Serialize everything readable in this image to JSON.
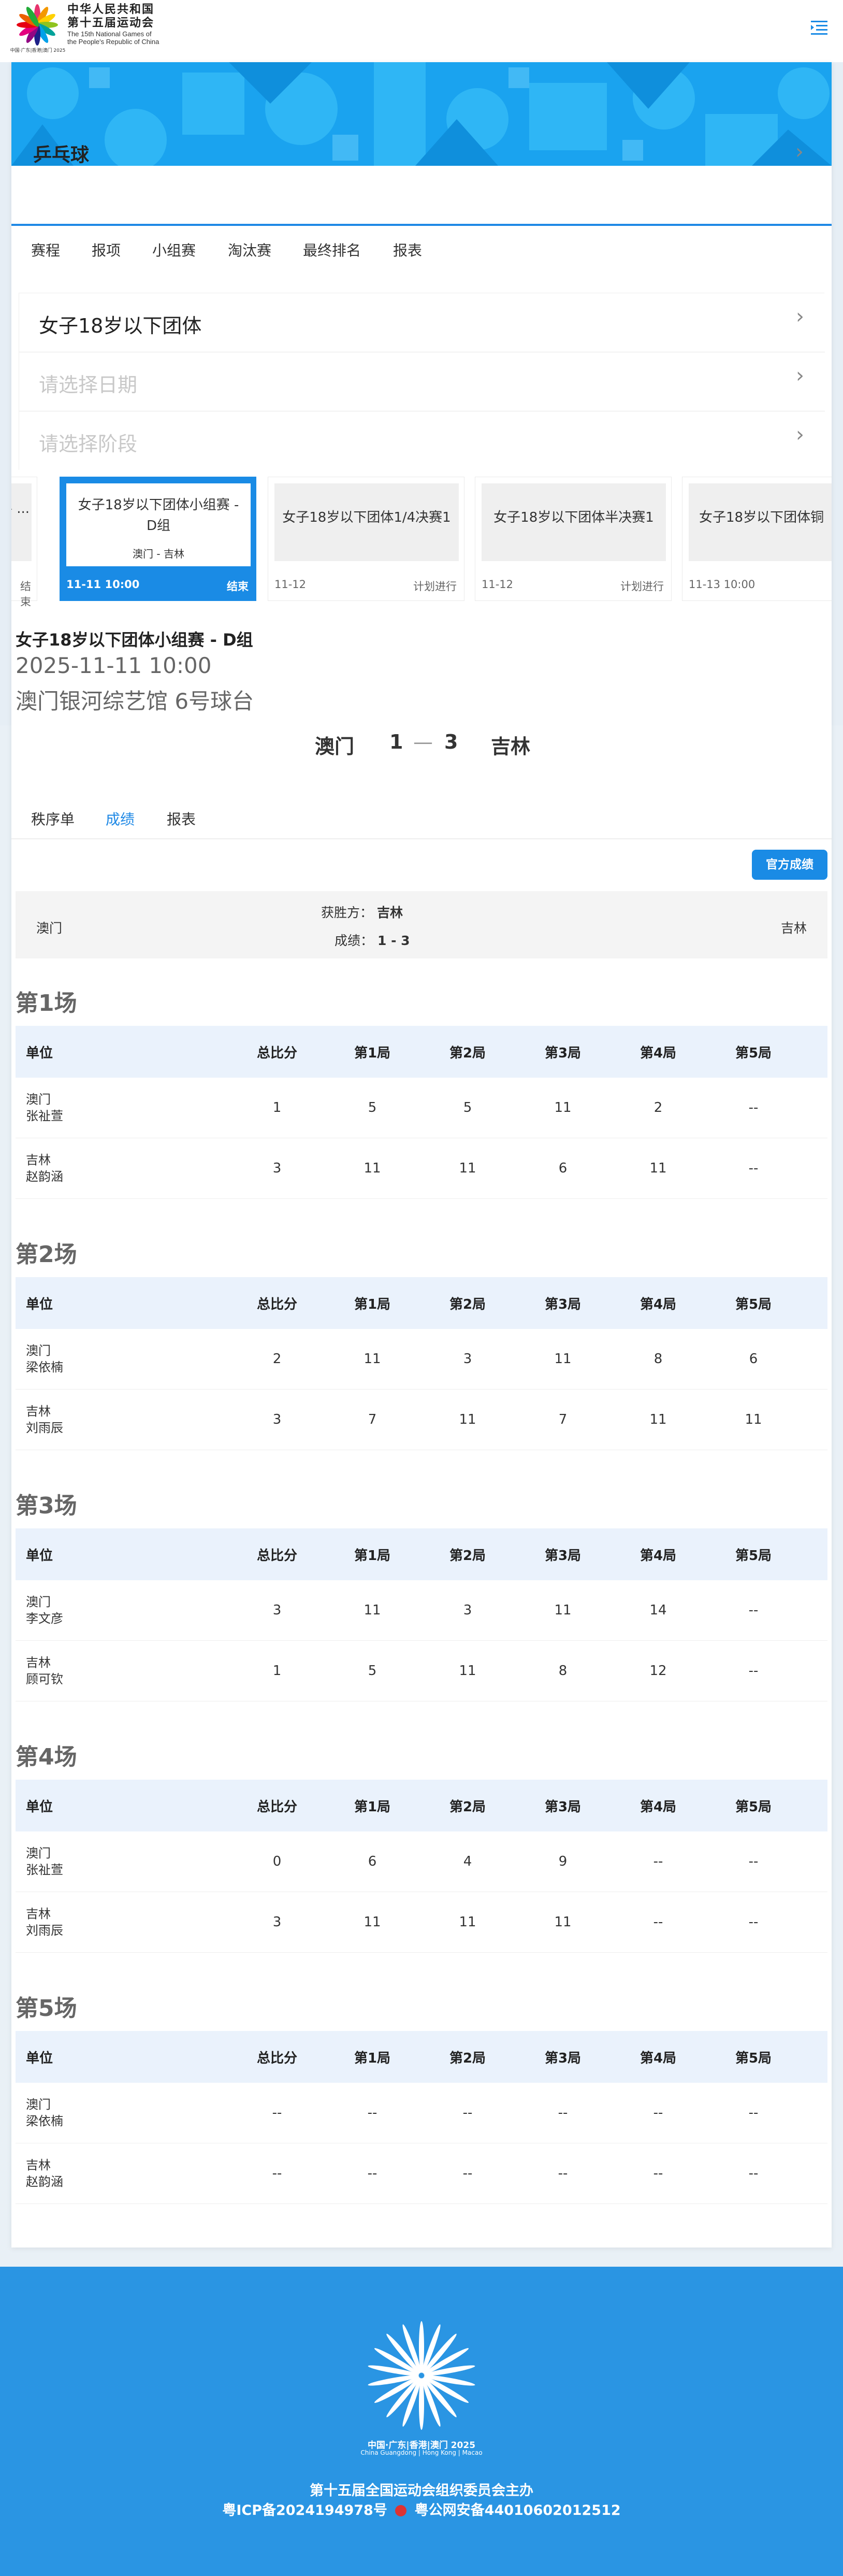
{
  "header": {
    "logo_cn_1": "中华人民共和国",
    "logo_cn_2": "第十五届运动会",
    "logo_en_1": "The 15th National Games of",
    "logo_en_2": "the People's Republic of China",
    "logo_caption": "中国·广东|香港|澳门 2025"
  },
  "sport": {
    "title": "乒乓球"
  },
  "tabs": [
    "赛程",
    "报项",
    "小组赛",
    "淘汰赛",
    "最终排名",
    "报表"
  ],
  "selector": {
    "event": "女子18岁以下团体",
    "date_placeholder": "请选择日期",
    "stage_placeholder": "请选择阶段"
  },
  "matches": [
    {
      "name": "- ...",
      "sub": "",
      "date": "结束",
      "status": ""
    },
    {
      "name": "女子18岁以下团体小组赛 - D组",
      "sub": "澳门 - 吉林",
      "date": "11-11 10:00",
      "status": "结束"
    },
    {
      "name": "女子18岁以下团体1/4决赛1",
      "sub": "",
      "date": "11-12",
      "status": "计划进行"
    },
    {
      "name": "女子18岁以下团体半决赛1",
      "sub": "",
      "date": "11-12",
      "status": "计划进行"
    },
    {
      "name": "女子18岁以下团体铜",
      "sub": "",
      "date": "11-13 10:00",
      "status": ""
    }
  ],
  "match": {
    "title": "女子18岁以下团体小组赛 - D组",
    "time": "2025-11-11 10:00",
    "venue": "澳门银河综艺馆 6号球台",
    "home": "澳门",
    "home_score": "1",
    "sep": "—",
    "away_score": "3",
    "away": "吉林"
  },
  "subtabs": [
    "秩序单",
    "成绩",
    "报表"
  ],
  "official_button": "官方成绩",
  "summary": {
    "home": "澳门",
    "away": "吉林",
    "winner_label": "获胜方：",
    "winner": "吉林",
    "score_label": "成绩：",
    "score": "1 - 3"
  },
  "table_headers": [
    "单位",
    "总比分",
    "第1局",
    "第2局",
    "第3局",
    "第4局",
    "第5局"
  ],
  "games": [
    {
      "title": "第1场",
      "rows": [
        {
          "team": "澳门",
          "player": "张祉萱",
          "vals": [
            "1",
            "5",
            "5",
            "11",
            "2",
            "--"
          ]
        },
        {
          "team": "吉林",
          "player": "赵韵涵",
          "vals": [
            "3",
            "11",
            "11",
            "6",
            "11",
            "--"
          ]
        }
      ]
    },
    {
      "title": "第2场",
      "rows": [
        {
          "team": "澳门",
          "player": "梁依楠",
          "vals": [
            "2",
            "11",
            "3",
            "11",
            "8",
            "6"
          ]
        },
        {
          "team": "吉林",
          "player": "刘雨辰",
          "vals": [
            "3",
            "7",
            "11",
            "7",
            "11",
            "11"
          ]
        }
      ]
    },
    {
      "title": "第3场",
      "rows": [
        {
          "team": "澳门",
          "player": "李文彦",
          "vals": [
            "3",
            "11",
            "3",
            "11",
            "14",
            "--"
          ]
        },
        {
          "team": "吉林",
          "player": "顾可钦",
          "vals": [
            "1",
            "5",
            "11",
            "8",
            "12",
            "--"
          ]
        }
      ]
    },
    {
      "title": "第4场",
      "rows": [
        {
          "team": "澳门",
          "player": "张祉萱",
          "vals": [
            "0",
            "6",
            "4",
            "9",
            "--",
            "--"
          ]
        },
        {
          "team": "吉林",
          "player": "刘雨辰",
          "vals": [
            "3",
            "11",
            "11",
            "11",
            "--",
            "--"
          ]
        }
      ]
    },
    {
      "title": "第5场",
      "rows": [
        {
          "team": "澳门",
          "player": "梁依楠",
          "vals": [
            "--",
            "--",
            "--",
            "--",
            "--",
            "--"
          ]
        },
        {
          "team": "吉林",
          "player": "赵韵涵",
          "vals": [
            "--",
            "--",
            "--",
            "--",
            "--",
            "--"
          ]
        }
      ]
    }
  ],
  "footer": {
    "logo_caption": "中国·广东|香港|澳门 2025",
    "logo_caption_en": "China Guangdong | Hong Kong | Macao",
    "organizer": "第十五届全国运动会组织委员会主办",
    "icp": "粤ICP备2024194978号",
    "police": "粤公网安备44010602012512"
  },
  "colors": {
    "accent": "#1a8be5",
    "footer": "#2a95e3",
    "header_row": "#eaf2fc"
  }
}
